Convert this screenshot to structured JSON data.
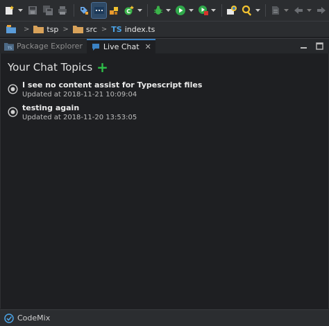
{
  "breadcrumb": {
    "items": [
      {
        "label": "tsp",
        "icon": "folder-icon"
      },
      {
        "label": "src",
        "icon": "folder-icon"
      },
      {
        "label": "index.ts",
        "icon": "typescript-file-icon",
        "prefix": "TS"
      }
    ]
  },
  "tabs": [
    {
      "label": "Package Explorer",
      "active": false
    },
    {
      "label": "Live Chat",
      "active": true
    }
  ],
  "panel": {
    "title": "Your Chat Topics",
    "add_label": "+",
    "topics": [
      {
        "title": "I see no content assist for Typescript files",
        "updated": "Updated at 2018-11-21 10:09:04"
      },
      {
        "title": "testing again",
        "updated": "Updated at 2018-11-20 13:53:05"
      }
    ]
  },
  "status": {
    "label": "CodeMix"
  },
  "colors": {
    "accent": "#3b82c4",
    "add": "#2ec04a",
    "background": "#1e1f22"
  }
}
